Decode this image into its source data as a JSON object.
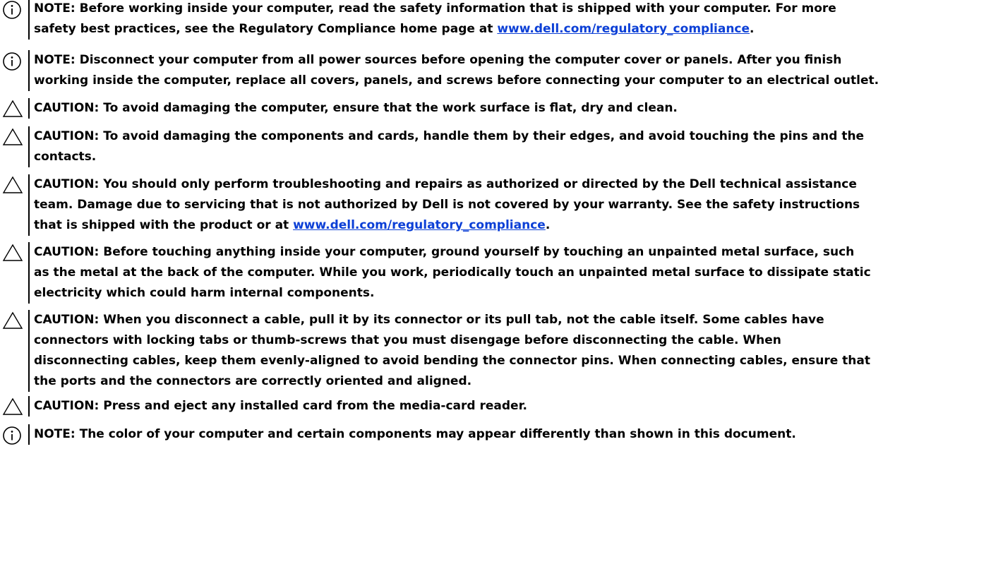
{
  "notices": [
    {
      "type": "note",
      "icon": "info-icon",
      "lines": [
        "NOTE: Before working inside your computer, read the safety information that is shipped with your computer. For more",
        "safety best practices, see the Regulatory Compliance home page at "
      ],
      "link": "www.dell.com/regulatory_compliance",
      "after_link": "."
    },
    {
      "type": "note",
      "icon": "info-icon",
      "lines": [
        "NOTE: Disconnect your computer from all power sources before opening the computer cover or panels. After you finish",
        "working inside the computer, replace all covers, panels, and screws before connecting your computer to an electrical outlet."
      ]
    },
    {
      "type": "caution",
      "icon": "caution-triangle-icon",
      "lines": [
        "CAUTION: To avoid damaging the computer, ensure that the work surface is flat, dry and clean."
      ]
    },
    {
      "type": "caution",
      "icon": "caution-triangle-icon",
      "lines": [
        "CAUTION: To avoid damaging the components and cards, handle them by their edges, and avoid touching the pins and the",
        "contacts."
      ]
    },
    {
      "type": "caution",
      "icon": "caution-triangle-icon",
      "lines": [
        "CAUTION: You should only perform troubleshooting and repairs as authorized or directed by the Dell technical assistance",
        "team. Damage due to servicing that is not authorized by Dell is not covered by your warranty. See the safety instructions",
        "that is shipped with the product or at "
      ],
      "link": "www.dell.com/regulatory_compliance",
      "after_link": "."
    },
    {
      "type": "caution",
      "icon": "caution-triangle-icon",
      "lines": [
        "CAUTION: Before touching anything inside your computer, ground yourself by touching an unpainted metal surface, such",
        "as the metal at the back of the computer. While you work, periodically touch an unpainted metal surface to dissipate static",
        "electricity which could harm internal components."
      ]
    },
    {
      "type": "caution",
      "icon": "caution-triangle-icon",
      "lines": [
        "CAUTION: When you disconnect a cable, pull it by its connector or its pull tab, not the cable itself. Some cables have",
        "connectors with locking tabs or thumb-screws that you must disengage before disconnecting the cable. When",
        "disconnecting cables, keep them evenly-aligned to avoid bending the connector pins. When connecting cables, ensure that",
        "the ports and the connectors are correctly oriented and aligned."
      ]
    },
    {
      "type": "caution",
      "icon": "caution-triangle-icon",
      "lines": [
        "CAUTION: Press and eject any installed card from the media-card reader."
      ]
    },
    {
      "type": "note",
      "icon": "info-icon",
      "lines": [
        "NOTE: The color of your computer and certain components may appear differently than shown in this document."
      ]
    }
  ],
  "colors": {
    "text": "#000000",
    "link": "#0b3fd6"
  }
}
